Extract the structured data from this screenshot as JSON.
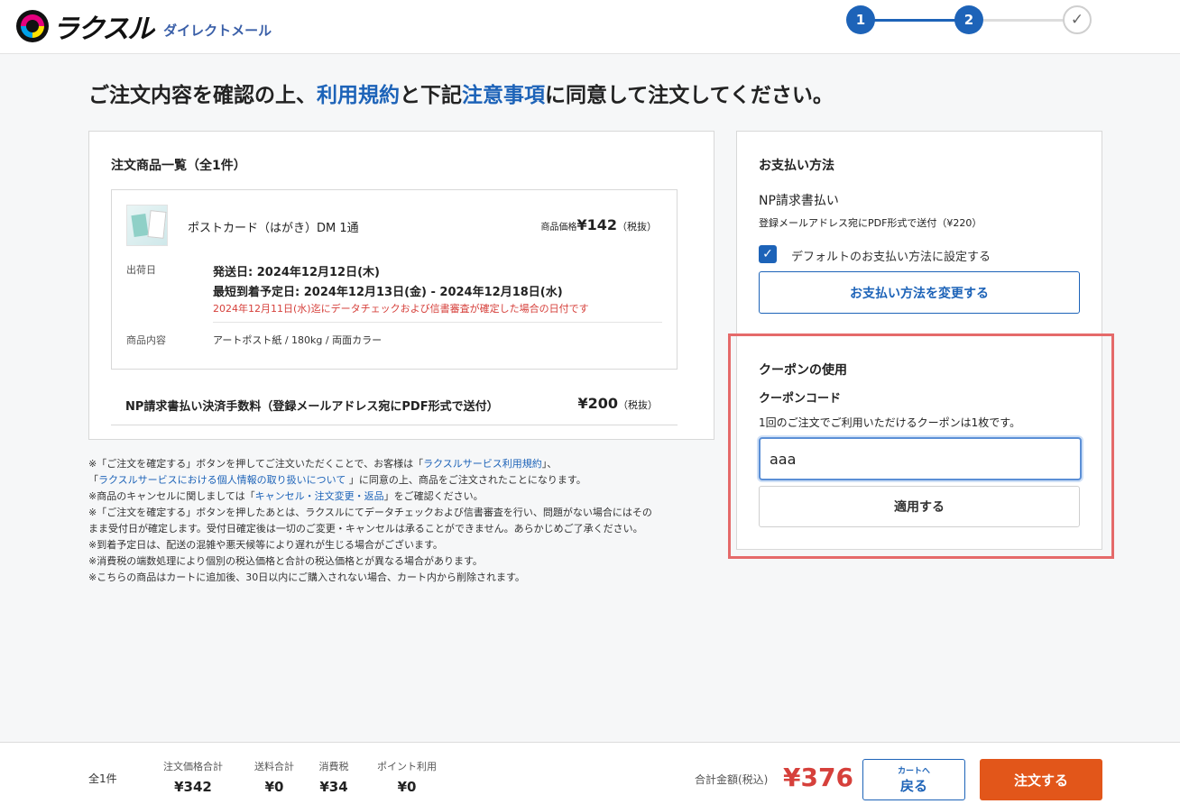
{
  "header": {
    "logo_text": "ラクスル",
    "logo_sub": "ダイレクトメール",
    "steps": [
      "1",
      "2",
      "✓"
    ]
  },
  "headline": {
    "part1": "ご注文内容を確認の上、",
    "link1": "利用規約",
    "part2": "と下記",
    "link2": "注意事項",
    "part3": "に同意して注文してください。"
  },
  "order": {
    "title": "注文商品一覧（全1件）",
    "item": {
      "name": "ポストカード（はがき）DM 1通",
      "price_label": "商品価格",
      "price": "¥142",
      "tax_note": "（税抜）",
      "ship_label": "出荷日",
      "ship_date": "発送日: 2024年12月12日(木)",
      "arrival": "最短到着予定日: 2024年12月13日(金) - 2024年12月18日(水)",
      "ship_note": "2024年12月11日(水)迄にデータチェックおよび信書審査が確定した場合の日付です",
      "spec_label": "商品内容",
      "spec": "アートポスト紙 / 180kg / 両面カラー"
    },
    "fee": {
      "label": "NP請求書払い決済手数料（登録メールアドレス宛にPDF形式で送付）",
      "price": "¥200",
      "tax_note": "（税抜）"
    }
  },
  "notes": {
    "n1a": "※「ご注文を確定する」ボタンを押してご注文いただくことで、お客様は「",
    "n1link": "ラクスルサービス利用規約",
    "n1b": "」、",
    "n2a": "「",
    "n2link": "ラクスルサービスにおける個人情報の取り扱いについて",
    "n2b": " 」に同意の上、商品をご注文されたことになります。",
    "n3a": "※商品のキャンセルに関しましては「",
    "n3link": "キャンセル・注文変更・返品",
    "n3b": "」をご確認ください。",
    "n4": "※「ご注文を確定する」ボタンを押したあとは、ラクスルにてデータチェックおよび信書審査を行い、問題がない場合にはその",
    "n5": "まま受付日が確定します。受付日確定後は一切のご変更・キャンセルは承ることができません。あらかじめご了承ください。",
    "n6": "※到着予定日は、配送の混雑や悪天候等により遅れが生じる場合がございます。",
    "n7": "※消費税の端数処理により個別の税込価格と合計の税込価格とが異なる場合があります。",
    "n8": "※こちらの商品はカートに追加後、30日以内にご購入されない場合、カート内から削除されます。"
  },
  "payment": {
    "title": "お支払い方法",
    "method": "NP請求書払い",
    "desc": "登録メールアドレス宛にPDF形式で送付（¥220）",
    "default_label": "デフォルトのお支払い方法に設定する",
    "change_button": "お支払い方法を変更する"
  },
  "coupon": {
    "title": "クーポンの使用",
    "code_label": "クーポンコード",
    "desc": "1回のご注文でご利用いただけるクーポンは1枚です。",
    "input_value": "aaa",
    "apply_button": "適用する",
    "highlight_color": "#e56a6a"
  },
  "footer": {
    "count": "全1件",
    "subtotal_label": "注文価格合計",
    "subtotal": "¥342",
    "shipping_label": "送料合計",
    "shipping": "¥0",
    "tax_label": "消費税",
    "tax": "¥34",
    "points_label": "ポイント利用",
    "points": "¥0",
    "total_label": "合計金額(税込)",
    "total": "¥376",
    "back_small": "カートへ",
    "back_big": "戻る",
    "order_button": "注文する"
  },
  "colors": {
    "accent": "#1d63b8",
    "price_red": "#d6403b",
    "order_orange": "#e2561a"
  }
}
